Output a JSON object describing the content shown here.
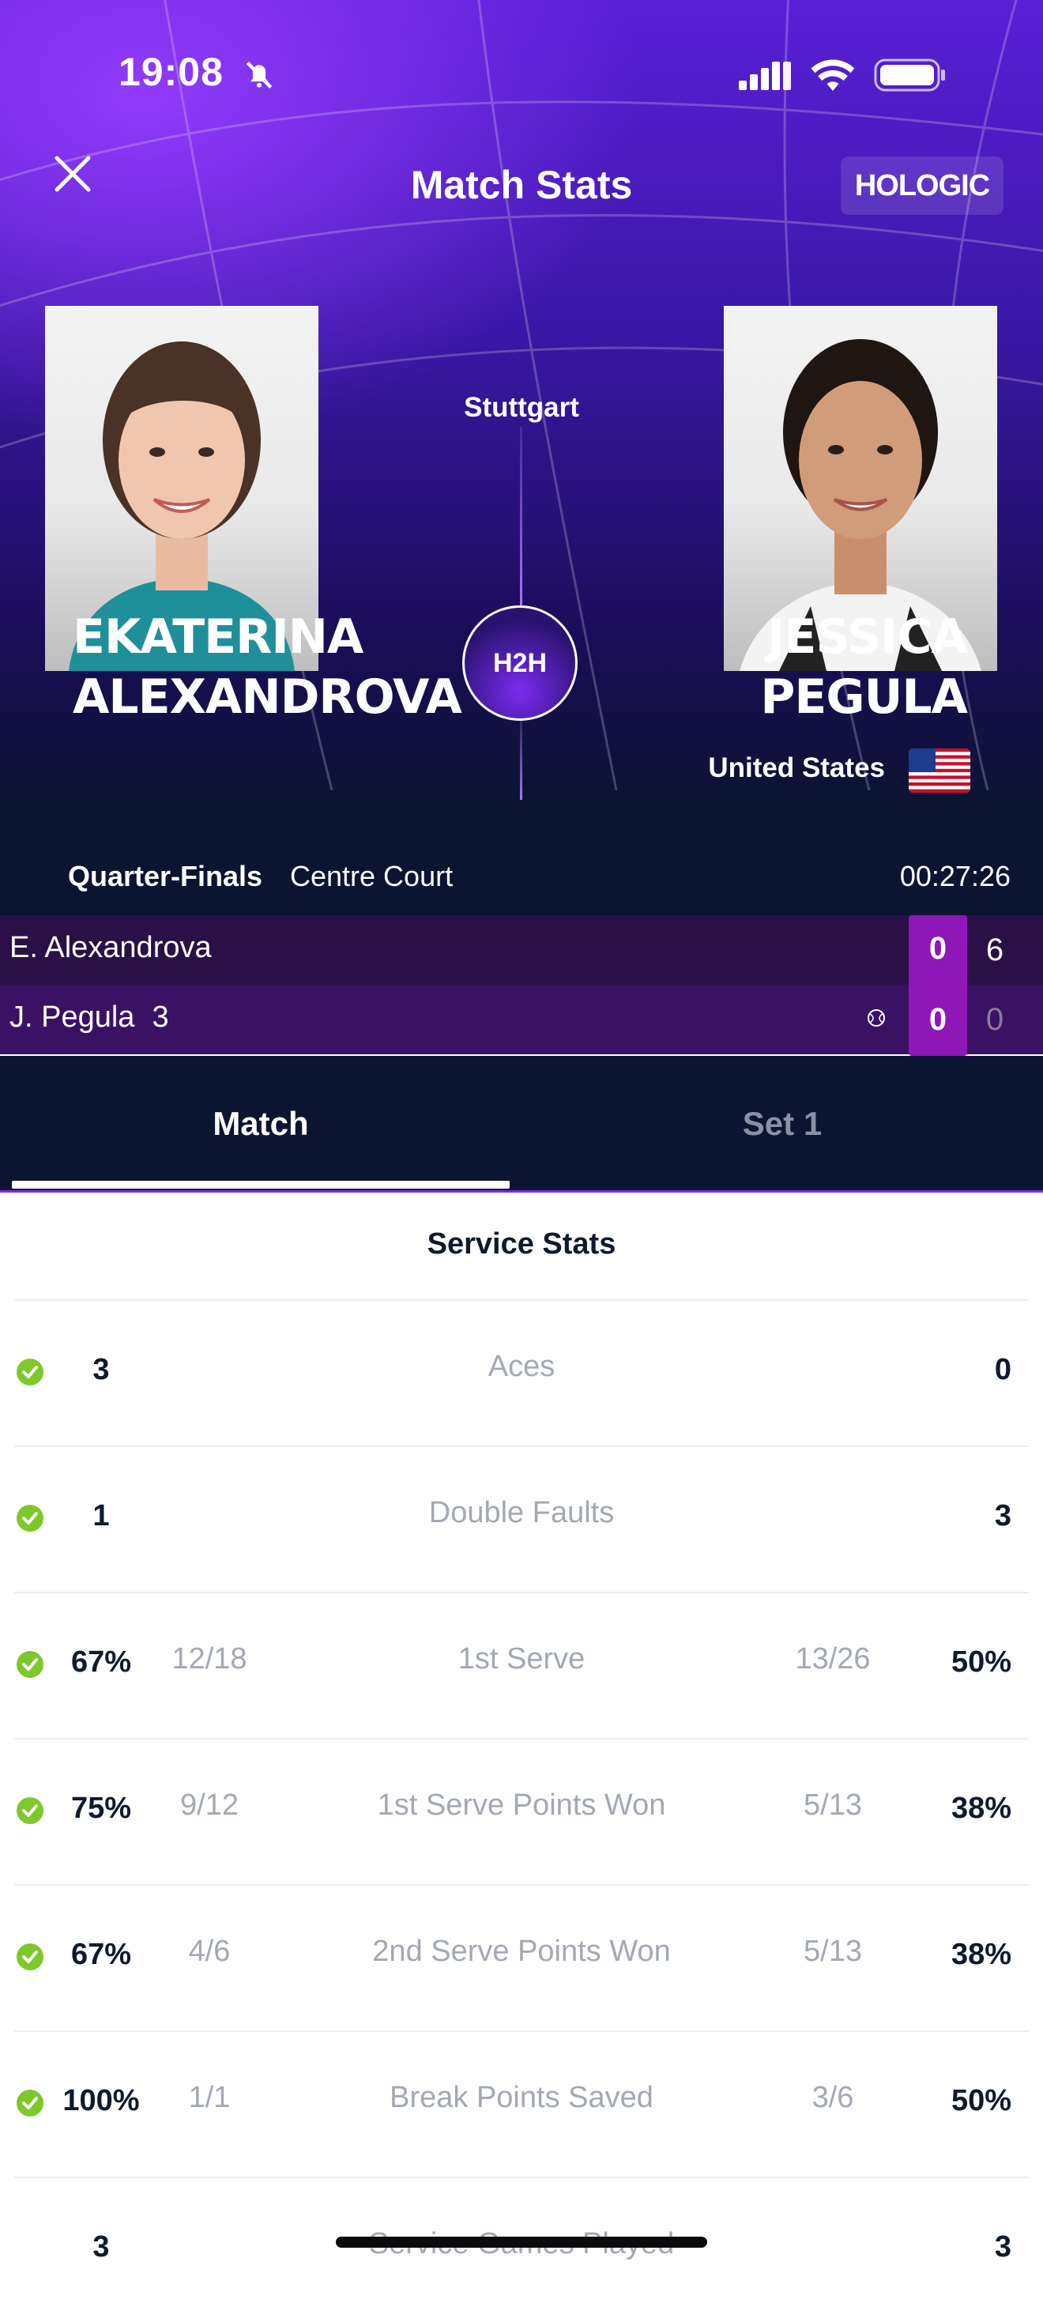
{
  "status_bar": {
    "time": "19:08"
  },
  "header": {
    "title": "Match Stats",
    "sponsor": "HOLOGIC"
  },
  "players": {
    "left": {
      "first": "EKATERINA",
      "last": "ALEXANDROVA"
    },
    "right": {
      "first": "JESSICA",
      "last": "PEGULA",
      "country": "United States"
    }
  },
  "venue": "Stuttgart",
  "h2h_label": "H2H",
  "match_info": {
    "round": "Quarter-Finals",
    "court": "Centre Court",
    "elapsed": "00:27:26"
  },
  "scoreboard": {
    "rows": [
      {
        "name": "E. Alexandrova",
        "seed": "",
        "game": "0",
        "set1": "6"
      },
      {
        "name": "J. Pegula",
        "seed": "3",
        "game": "0",
        "set1": "0"
      }
    ]
  },
  "tabs": [
    "Match",
    "Set 1"
  ],
  "section_title": "Service Stats",
  "stats": [
    {
      "label": "Aces",
      "left": "3",
      "left_raw": "",
      "right": "0",
      "right_raw": "",
      "left_better": true
    },
    {
      "label": "Double Faults",
      "left": "1",
      "left_raw": "",
      "right": "3",
      "right_raw": "",
      "left_better": true
    },
    {
      "label": "1st Serve",
      "left": "67%",
      "left_raw": "12/18",
      "right": "50%",
      "right_raw": "13/26",
      "left_better": true
    },
    {
      "label": "1st Serve Points Won",
      "left": "75%",
      "left_raw": "9/12",
      "right": "38%",
      "right_raw": "5/13",
      "left_better": true
    },
    {
      "label": "2nd Serve Points Won",
      "left": "67%",
      "left_raw": "4/6",
      "right": "38%",
      "right_raw": "5/13",
      "left_better": true
    },
    {
      "label": "Break Points Saved",
      "left": "100%",
      "left_raw": "1/1",
      "right": "50%",
      "right_raw": "3/6",
      "left_better": true
    },
    {
      "label": "Service Games Played",
      "left": "3",
      "left_raw": "",
      "right": "3",
      "right_raw": "",
      "left_better": false
    }
  ],
  "colors": {
    "accent": "#8f17b8",
    "check": "#7dc82a",
    "hero_dark": "#0b1430"
  }
}
